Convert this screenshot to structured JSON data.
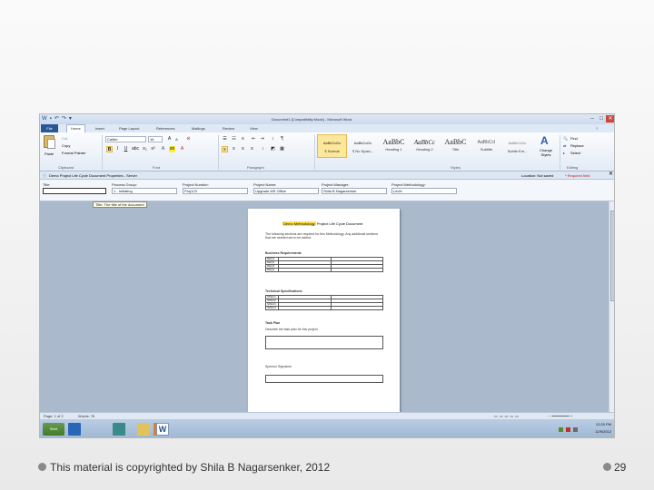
{
  "window": {
    "title": "Document1 [Compatibility Mode] - Microsoft Word",
    "min": "–",
    "max": "□",
    "close": "✕"
  },
  "quick_access": [
    "W",
    "▪",
    "↶",
    "↷",
    "▾"
  ],
  "tabs": [
    "File",
    "Home",
    "Insert",
    "Page Layout",
    "References",
    "Mailings",
    "Review",
    "View"
  ],
  "ribbon": {
    "clipboard": {
      "paste": "Paste",
      "cut": "Cut",
      "copy": "Copy",
      "format_painter": "Format Painter",
      "label": "Clipboard"
    },
    "font": {
      "name": "Calibri",
      "size": "16",
      "label": "Font",
      "grow": "A",
      "shrink": "A",
      "bold": "B",
      "italic": "I",
      "underline": "U"
    },
    "paragraph": {
      "label": "Paragraph"
    },
    "styles": {
      "items": [
        {
          "sample": "AaBbCcDc",
          "name": "¶ Normal"
        },
        {
          "sample": "AaBbCcDc",
          "name": "¶ No Spaci..."
        },
        {
          "sample": "AaBbC",
          "name": "Heading 1"
        },
        {
          "sample": "AaBbCc",
          "name": "Heading 2"
        },
        {
          "sample": "AaBbC",
          "name": "Title"
        },
        {
          "sample": "AaBbCcI",
          "name": "Subtitle"
        },
        {
          "sample": "AaBbCcDu",
          "name": "Subtle Em..."
        }
      ],
      "change": "Change Styles",
      "label": "Styles"
    },
    "editing": {
      "find": "Find",
      "replace": "Replace",
      "select": "Select",
      "label": "Editing"
    }
  },
  "doc_props": {
    "header": "Demo Project Life Cycle Document Properties - Server",
    "location": "Location: Not saved",
    "required": "* Required field",
    "fields": [
      {
        "label": "Title:",
        "value": ""
      },
      {
        "label": "Process Group:",
        "value": "1 - Initiating"
      },
      {
        "label": "Project Number:",
        "value": "Proj123"
      },
      {
        "label": "Project Name:",
        "value": "Upgrade MS Office"
      },
      {
        "label": "Project Manager:",
        "value": "Shila B Nagarsenker"
      },
      {
        "label": "Project Methodology:",
        "value": "Level"
      }
    ],
    "tooltip": "Title: The title of the document"
  },
  "document": {
    "title_highlight": "Demo Methodology",
    "title_rest": "Project Life Cycle Document",
    "intro": "The following sections are required for this Methodology. Any additional sections that are needed are to be added.",
    "business_heading": "Business Requirements",
    "business_rows": [
      "REQ1",
      "REQ2",
      "REQ3",
      "REQ4"
    ],
    "technical_heading": "Technical Specifications",
    "technical_rows": [
      "SPEC1",
      "SPEC2",
      "SPEC3",
      "SPEC4"
    ],
    "task_heading": "Task Plan",
    "task_text": "Describe the task plan for this project.",
    "signature_heading": "Sponsor Signature"
  },
  "status_bar": {
    "page": "Page: 1 of 2",
    "words": "Words: 76"
  },
  "taskbar": {
    "start": "Start",
    "time": "12:25 PM",
    "date": "12/9/2012"
  },
  "footer": {
    "copyright": "This material is copyrighted by Shila B Nagarsenker, 2012",
    "page_number": "29"
  }
}
